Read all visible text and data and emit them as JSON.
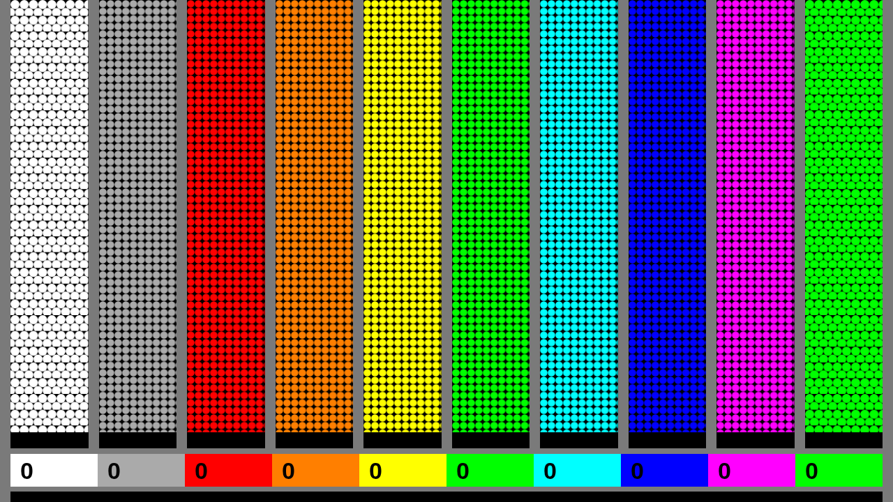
{
  "tubes": [
    {
      "color": "#ffffff",
      "kind": "loose"
    },
    {
      "color": "#aaaaaa",
      "kind": "packed"
    },
    {
      "color": "#ff0000",
      "kind": "packed"
    },
    {
      "color": "#ff7f00",
      "kind": "packed"
    },
    {
      "color": "#ffff00",
      "kind": "packed"
    },
    {
      "color": "#00ff00",
      "kind": "packed"
    },
    {
      "color": "#00ffff",
      "kind": "packed"
    },
    {
      "color": "#0000ff",
      "kind": "packed"
    },
    {
      "color": "#ff00ff",
      "kind": "packed"
    },
    {
      "color": "#00ff00",
      "kind": "loose"
    }
  ],
  "scores": [
    {
      "value": "0",
      "color": "#ffffff"
    },
    {
      "value": "0",
      "color": "#aaaaaa"
    },
    {
      "value": "0",
      "color": "#ff0000"
    },
    {
      "value": "0",
      "color": "#ff7f00"
    },
    {
      "value": "0",
      "color": "#ffff00"
    },
    {
      "value": "0",
      "color": "#00ff00"
    },
    {
      "value": "0",
      "color": "#00ffff"
    },
    {
      "value": "0",
      "color": "#0000ff"
    },
    {
      "value": "0",
      "color": "#ff00ff"
    },
    {
      "value": "0",
      "color": "#00ff00"
    }
  ]
}
